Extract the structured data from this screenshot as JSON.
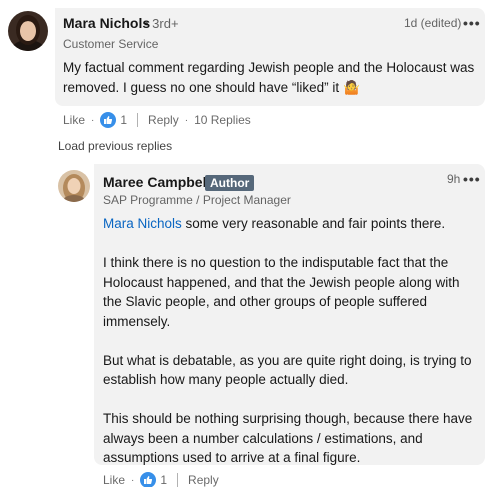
{
  "comment": {
    "author": "Mara Nichols",
    "degree": "• 3rd+",
    "headline": "Customer Service",
    "time": "1d (edited)",
    "more_icon": "ellipsis-icon",
    "text_line1": "My factual comment regarding Jewish people and the Holocaust was",
    "text_line2": "removed. I guess no one should have “liked” it",
    "text_emoji": "🤷",
    "actions": {
      "like": "Like",
      "like_count": "1",
      "reply": "Reply",
      "replies": "10 Replies"
    }
  },
  "load_previous": "Load previous replies",
  "reply": {
    "author": "Maree Campbell",
    "badge": "Author",
    "headline": "SAP Programme / Project Manager",
    "time": "9h",
    "more_icon": "ellipsis-icon",
    "mention": "Mara Nichols",
    "para1_rest": " some very reasonable and fair points there.",
    "para2": "I think there is no question to the indisputable fact that the Holocaust happened, and that the Jewish people along with the Slavic people, and other groups of people suffered immensely.",
    "para3": "But what is debatable, as you are quite right doing, is trying to establish how many people actually died.",
    "para4": "This should be nothing surprising though, because there have always been a number calculations / estimations, and assumptions used to arrive at a final figure.",
    "actions": {
      "like": "Like",
      "like_count": "1",
      "reply": "Reply"
    }
  },
  "colors": {
    "link": "#0a66c2",
    "bubble": "#f2f2f2",
    "badge": "#56687a",
    "like_blue": "#378fe9"
  }
}
